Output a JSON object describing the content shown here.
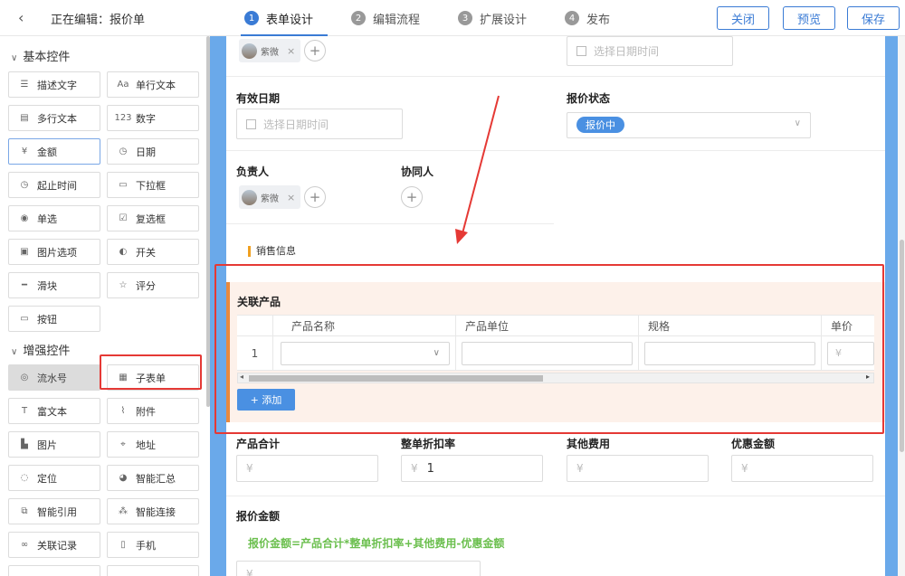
{
  "header": {
    "back_icon": "chevron-left-icon",
    "editing_label": "正在编辑：报价单",
    "steps": [
      {
        "num": "1",
        "label": "表单设计"
      },
      {
        "num": "2",
        "label": "编辑流程"
      },
      {
        "num": "3",
        "label": "扩展设计"
      },
      {
        "num": "4",
        "label": "发布"
      }
    ],
    "buttons": {
      "close": "关闭",
      "preview": "预览",
      "save": "保存"
    }
  },
  "left_panel": {
    "basic_group": "基本控件",
    "basic_controls": [
      "描述文字",
      "单行文本",
      "多行文本",
      "数字",
      "金额",
      "日期",
      "起止时间",
      "下拉框",
      "单选",
      "复选框",
      "图片选项",
      "开关",
      "滑块",
      "评分",
      "按钮"
    ],
    "advanced_group": "增强控件",
    "advanced_controls": [
      "流水号",
      "子表单",
      "富文本",
      "附件",
      "图片",
      "地址",
      "定位",
      "智能汇总",
      "智能引用",
      "智能连接",
      "关联记录",
      "手机"
    ]
  },
  "form": {
    "top_user": "紫微",
    "top_date_placeholder": "选择日期时间",
    "valid_date_label": "有效日期",
    "valid_date_placeholder": "选择日期时间",
    "quote_status_label": "报价状态",
    "quote_status_value": "报价中",
    "owner_label": "负责人",
    "owner_user": "紫微",
    "collab_label": "协同人",
    "section_sales": "销售信息",
    "related_products_label": "关联产品",
    "subtable_columns": [
      "产品名称",
      "产品单位",
      "规格",
      "单价"
    ],
    "subtable_row_num": "1",
    "currency_symbol": "¥",
    "add_button": "+ 添加",
    "product_total_label": "产品合计",
    "discount_label": "整单折扣率",
    "discount_value": "1",
    "other_fees_label": "其他费用",
    "discount_amount_label": "优惠金额",
    "quote_amount_label": "报价金额",
    "formula": "报价金额=产品合计*整单折扣率+其他费用-优惠金额"
  },
  "colors": {
    "accent": "#3a7bd5",
    "annotation": "#e53935",
    "formula": "#6bbf4e"
  }
}
